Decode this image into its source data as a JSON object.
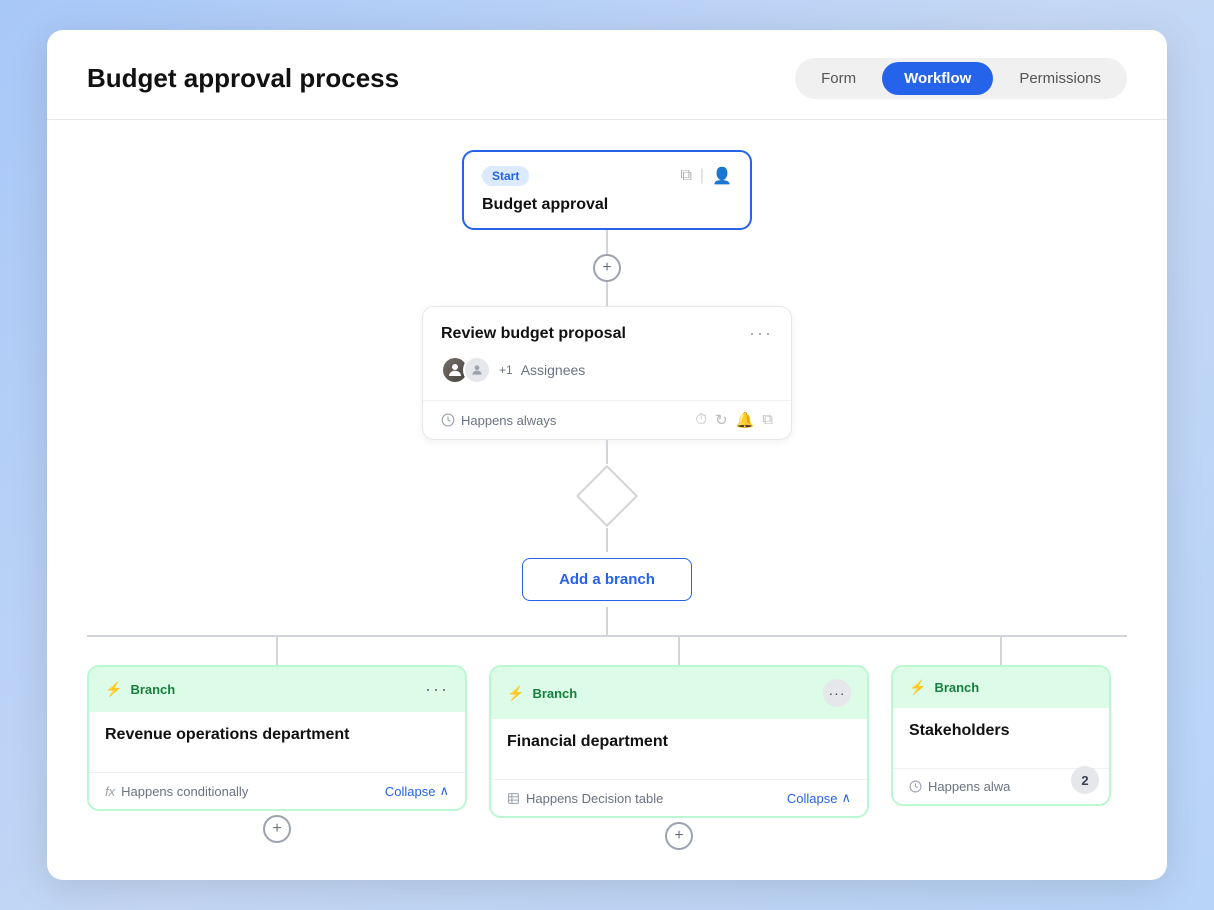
{
  "header": {
    "title": "Budget approval process",
    "tabs": [
      {
        "id": "form",
        "label": "Form",
        "active": false
      },
      {
        "id": "workflow",
        "label": "Workflow",
        "active": true
      },
      {
        "id": "permissions",
        "label": "Permissions",
        "active": false
      }
    ]
  },
  "workflow": {
    "start_node": {
      "badge": "Start",
      "title": "Budget approval"
    },
    "review_node": {
      "title": "Review budget proposal",
      "assignees_count": "+1",
      "assignees_label": "Assignees",
      "condition": "Happens always"
    },
    "branch_button": "Add a branch",
    "branches": [
      {
        "id": "branch1",
        "header_label": "Branch",
        "title": "Revenue operations department",
        "condition": "Happens conditionally",
        "collapse_label": "Collapse",
        "condition_icon": "fx"
      },
      {
        "id": "branch2",
        "header_label": "Branch",
        "title": "Financial department",
        "condition": "Happens Decision table",
        "collapse_label": "Collapse",
        "condition_icon": "table"
      },
      {
        "id": "branch3",
        "header_label": "Branch",
        "title": "Stakeholders",
        "condition": "Happens alwa",
        "condition_icon": "always",
        "overflow_count": "2"
      }
    ]
  }
}
